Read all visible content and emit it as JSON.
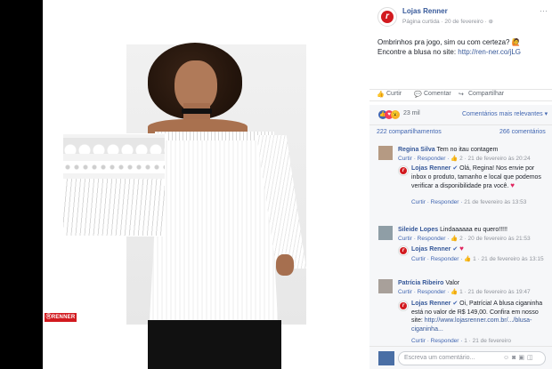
{
  "post": {
    "page_name": "Lojas Renner",
    "page_type": "Página curtida",
    "date": "20 de fevereiro",
    "text_line1": "Ombrinhos pra jogo, sim ou com certeza?",
    "text_line2_prefix": "Encontre a blusa no site:",
    "link": "http://ren-ner.co/jLG",
    "brand_badge": "ⓇRENNER"
  },
  "actions": {
    "like": "Curtir",
    "comment": "Comentar",
    "share": "Compartilhar"
  },
  "reactions": {
    "count": "23 mil",
    "sort": "Comentários mais relevantes",
    "shares": "222 compartilhamentos",
    "comments": "266 comentários"
  },
  "comments": [
    {
      "author": "Regina Silva",
      "text": "Tem no itau contagem",
      "meta_actions": "Curtir · Responder ·",
      "meta_rest": "2 · 21 de fevereiro às 20:24"
    },
    {
      "author": "Lojas Renner",
      "text": "Olá, Regina! Nos envie por inbox o produto, tamanho e local que podemos verificar a disponibilidade pra você.",
      "meta_actions": "Curtir · Responder ·",
      "meta_rest": "21 de fevereiro às 13:53"
    },
    {
      "author": "Sileide Lopes",
      "text": "Lindaaaaaa eu quero!!!!!",
      "meta_actions": "Curtir · Responder ·",
      "meta_rest": "2 · 20 de fevereiro às 21:53"
    },
    {
      "author": "Lojas Renner",
      "text": "",
      "meta_actions": "Curtir · Responder ·",
      "meta_rest": "1 · 21 de fevereiro às 13:15"
    },
    {
      "author": "Patrícia Ribeiro",
      "text": "Valor",
      "meta_actions": "Curtir · Responder ·",
      "meta_rest": "1 · 21 de fevereiro às 19:47"
    },
    {
      "author": "Lojas Renner",
      "text": "Oi, Patrícia! A blusa ciganinha está no valor de R$ 149,00. Confira em nosso site:",
      "link": "http://www.lojasrenner.com.br/.../blusa-ciganinha...",
      "meta_actions": "Curtir · Responder ·",
      "meta_rest": "1 · 21 de fevereiro"
    }
  ],
  "composer": {
    "placeholder": "Escreva um comentário..."
  },
  "colors": {
    "link": "#365899",
    "brand_red": "#d21a1f",
    "like_blue": "#4267b2"
  }
}
